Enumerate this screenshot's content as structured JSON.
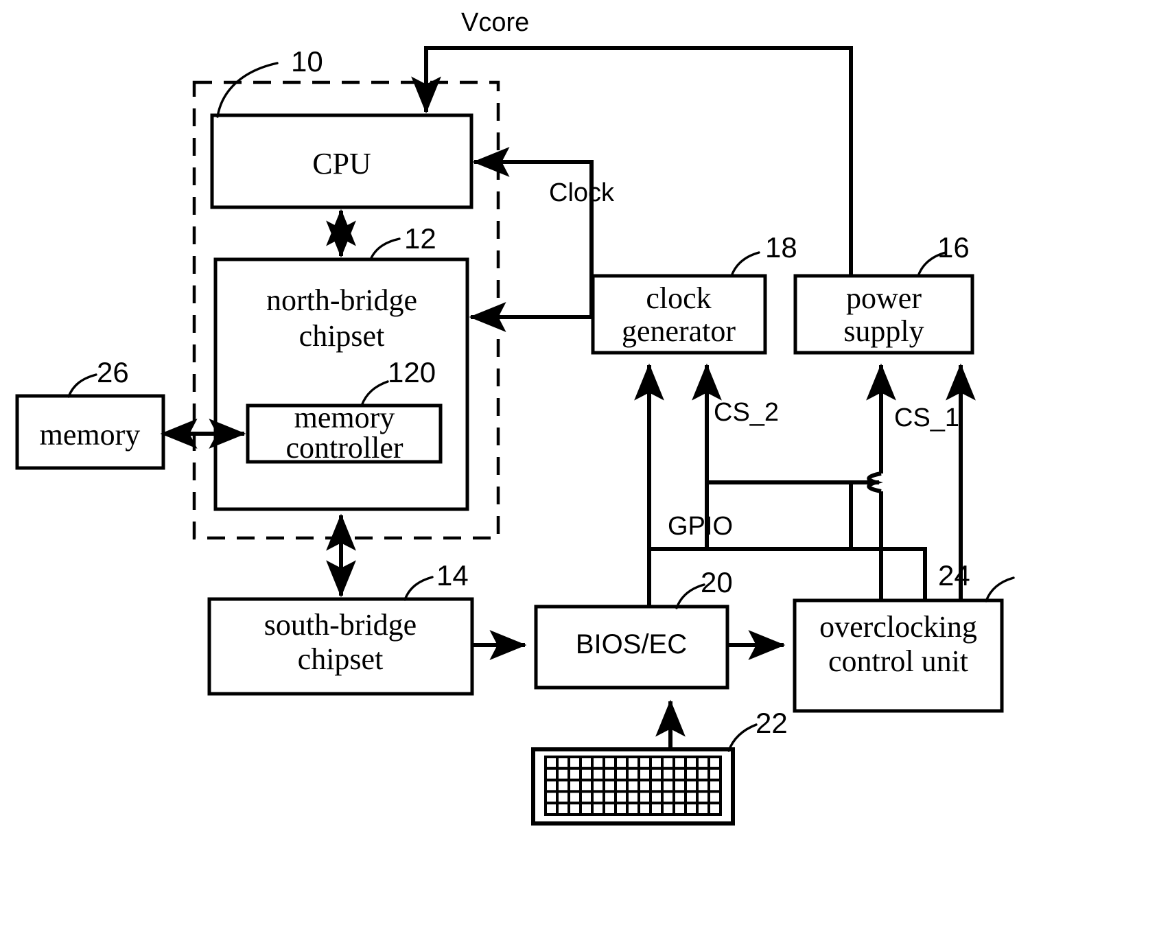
{
  "figure": {
    "kind": "patent-block-diagram",
    "description": "Computer system overclocking control block diagram"
  },
  "blocks": {
    "cpu": {
      "label": "CPU",
      "ref": "10"
    },
    "north_bridge": {
      "label_line1": "north-bridge",
      "label_line2": "chipset",
      "ref": "12"
    },
    "memory_controller": {
      "label_line1": "memory",
      "label_line2": "controller",
      "ref": "120"
    },
    "memory": {
      "label": "memory",
      "ref": "26"
    },
    "south_bridge": {
      "label_line1": "south-bridge",
      "label_line2": "chipset",
      "ref": "14"
    },
    "clock_generator": {
      "label_line1": "clock",
      "label_line2": "generator",
      "ref": "18"
    },
    "power_supply": {
      "label_line1": "power",
      "label_line2": "supply",
      "ref": "16"
    },
    "bios_ec": {
      "label": "BIOS/EC",
      "ref": "20"
    },
    "overclocking_control_unit": {
      "label_line1": "overclocking",
      "label_line2": "control unit",
      "ref": "24"
    },
    "keyboard": {
      "label": "",
      "ref": "22"
    }
  },
  "signals": {
    "vcore": "Vcore",
    "clock": "Clock",
    "cs_1": "CS_1",
    "cs_2": "CS_2",
    "gpio": "GPIO"
  },
  "refs": {
    "dashed_group": "10"
  },
  "colors": {
    "stroke": "#000000",
    "background": "#ffffff"
  }
}
